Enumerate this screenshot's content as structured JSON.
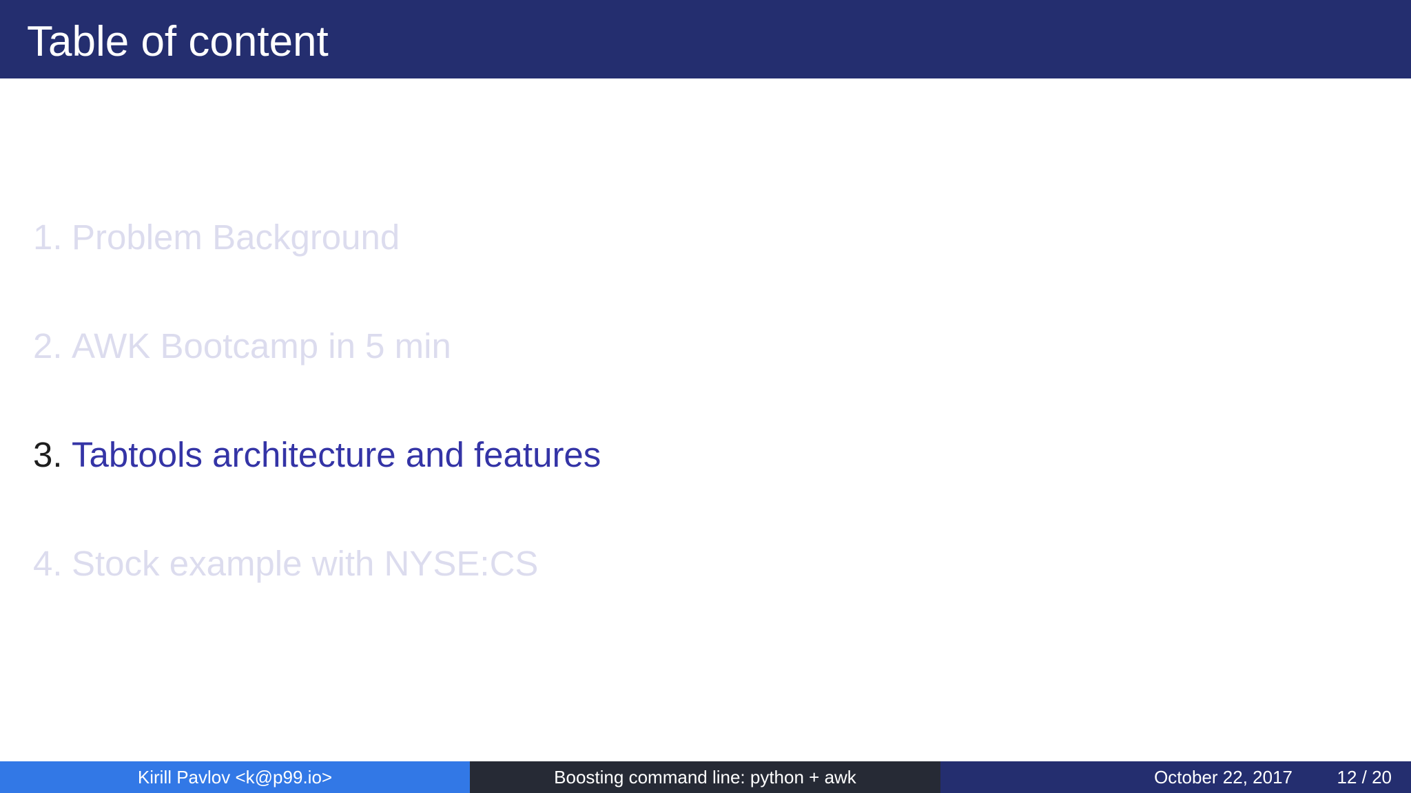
{
  "slide": {
    "title": "Table of content"
  },
  "toc": {
    "items": [
      {
        "number": "1.",
        "label": "Problem Background",
        "state": "inactive"
      },
      {
        "number": "2.",
        "label": "AWK Bootcamp in 5 min",
        "state": "inactive"
      },
      {
        "number": "3.",
        "label": "Tabtools architecture and features",
        "state": "active"
      },
      {
        "number": "4.",
        "label": "Stock example with NYSE:CS",
        "state": "inactive"
      }
    ]
  },
  "footer": {
    "author": "Kirill Pavlov <k@p99.io>",
    "talk_title": "Boosting command line: python + awk",
    "date": "October 22, 2017",
    "page": "12 / 20"
  },
  "colors": {
    "header_bg": "#242e6f",
    "footer_author_bg": "#3278e6",
    "footer_talk_bg": "#262a35",
    "active_label": "#3434a6",
    "inactive_text": "#dcdcee"
  }
}
